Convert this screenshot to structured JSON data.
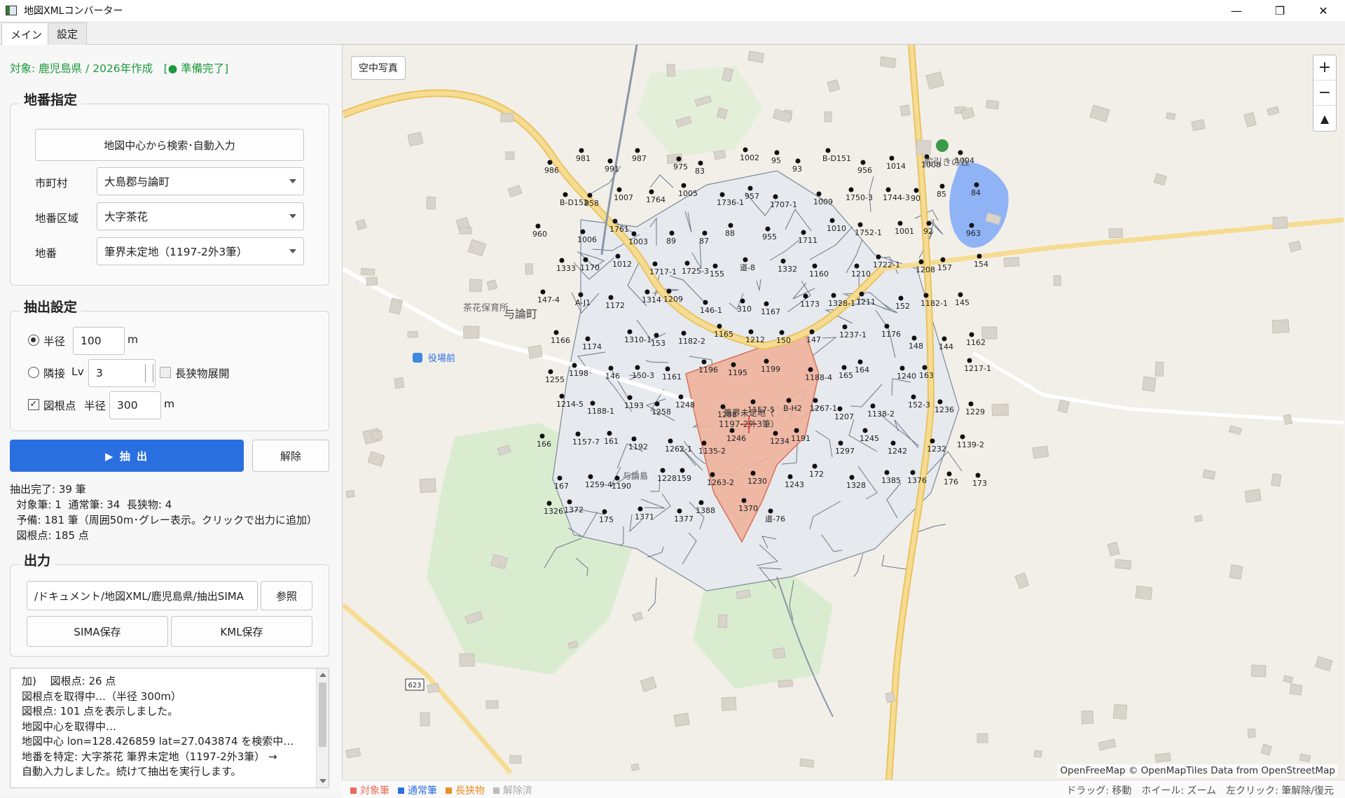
{
  "window": {
    "title": "地図XMLコンバーター",
    "minimize": "—",
    "maximize": "❐",
    "close": "✕"
  },
  "tabs": [
    "メイン",
    "設定"
  ],
  "status_line": "対象: 鹿児島県 / 2026年作成　[● 準備完了]",
  "chiban": {
    "title": "地番指定",
    "search_button": "地図中心から検索･自動入力",
    "municipality_label": "市町村",
    "municipality_value": "大島郡与論町",
    "area_label": "地番区域",
    "area_value": "大字茶花",
    "chiban_label": "地番",
    "chiban_value": "筆界未定地（1197-2外3筆）"
  },
  "extract": {
    "title": "抽出設定",
    "radius_label": "半径",
    "radius_value": "100",
    "radius_unit": "m",
    "adjacent_label": "隣接",
    "lv_label": "Lv",
    "lv_value": "3",
    "long_label": "長狭物展開",
    "toshikon_label": "図根点",
    "toshikon_radius_label": "半径",
    "toshikon_radius_value": "300",
    "toshikon_unit": "m",
    "extract_button": "▶ 抽 出",
    "clear_button": "解除"
  },
  "summary": {
    "line1": "抽出完了: 39 筆",
    "line2": "  対象筆: 1  通常筆: 34  長狭物: 4",
    "line3": "  予備: 181 筆（周囲50m･グレー表示。クリックで出力に追加）",
    "line4": "  図根点: 185 点"
  },
  "output": {
    "title": "出力",
    "path_value": "/ドキュメント/地図XML/鹿児島県/抽出SIMA",
    "browse_button": "参照",
    "sima_button": "SIMA保存",
    "kml_button": "KML保存"
  },
  "log": [
    "加)　 図根点: 26 点",
    "図根点を取得中…（半径 300m）",
    "図根点: 101 点を表示しました。",
    "地図中心を取得中…",
    "地図中心 lon=128.426859 lat=27.043874 を検索中…",
    "地番を特定: 大字茶花 筆界未定地（1197-2外3筆） →",
    "自動入力しました。続けて抽出を実行します。"
  ],
  "map": {
    "aerial_button": "空中写真",
    "zoom_in": "+",
    "zoom_out": "−",
    "compass": "▲",
    "attribution": "OpenFreeMap © OpenMapTiles Data from OpenStreetMap",
    "target_label_1": "筆界未定地（",
    "target_label_2": "1197-2外3筆）",
    "place_yoron": "与論町",
    "place_chabana_school": "茶花保育所",
    "place_yakuba": "役場前",
    "place_hill": "舵引きの丘",
    "place_island": "与論島",
    "road_623": "623",
    "colors": {
      "target": "#e86b5b",
      "normal": "#2a6fe0",
      "long": "#e8902a",
      "released": "#bbbbbb",
      "road": "#f3d27b",
      "water": "#8fb3f5",
      "green": "#d9ecd0"
    },
    "parcel_labels": [
      "986",
      "981",
      "991",
      "987",
      "975",
      "83",
      "1002",
      "95",
      "93",
      "B-D151",
      "956",
      "1014",
      "1008",
      "1004",
      "B-D152",
      "958",
      "1007",
      "1764",
      "1005",
      "1736-1",
      "957",
      "1707-1",
      "1009",
      "1750-3",
      "1744-3",
      "90",
      "85",
      "84",
      "960",
      "1006",
      "1761",
      "1003",
      "89",
      "87",
      "88",
      "955",
      "1711",
      "1010",
      "1752-1",
      "1001",
      "92",
      "963",
      "1333",
      "1170",
      "1012",
      "1717-1",
      "1725-3",
      "155",
      "道-8",
      "1332",
      "1160",
      "1210",
      "1722-1",
      "1208",
      "157",
      "154",
      "147-4",
      "A-J1",
      "1172",
      "1314",
      "1209",
      "146-1",
      "310",
      "1167",
      "1173",
      "1328-1",
      "1211",
      "152",
      "1182-1",
      "145",
      "1166",
      "1174",
      "1310-1",
      "153",
      "1182-2",
      "1165",
      "1212",
      "150",
      "147",
      "1237-1",
      "1176",
      "148",
      "144",
      "1162",
      "1255",
      "1198",
      "146",
      "150-3",
      "1161",
      "1196",
      "1195",
      "1199",
      "1188-4",
      "165",
      "164",
      "1240",
      "163",
      "1217-1",
      "1214-5",
      "1188-1",
      "1193",
      "1258",
      "1248",
      "1238",
      "1157-5",
      "B-H2",
      "1267-1",
      "1207",
      "1138-2",
      "152-3",
      "1236",
      "1229",
      "166",
      "1157-7",
      "161",
      "1192",
      "1262-1",
      "1135-2",
      "1246",
      "1234",
      "1191",
      "1297",
      "1245",
      "1242",
      "1232",
      "1139-2",
      "167",
      "1259-4",
      "1190",
      "1228",
      "159",
      "1263-2",
      "1230",
      "1243",
      "172",
      "1328",
      "1385",
      "1376",
      "176",
      "173",
      "1326",
      "1372",
      "175",
      "1371",
      "1377",
      "1388",
      "1370",
      "道-76"
    ]
  },
  "legend": {
    "target": "対象筆",
    "normal": "通常筆",
    "long": "長狭物",
    "released": "解除済"
  },
  "hint": "ドラッグ: 移動　ホイール: ズーム　左クリック: 筆解除/復元"
}
